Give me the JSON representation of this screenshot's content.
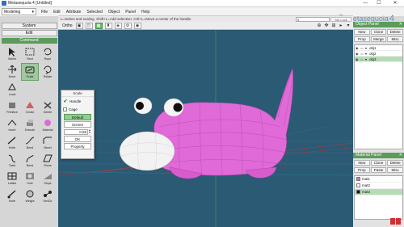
{
  "window": {
    "title": "Metasequoia 4 [Untitled]",
    "minimize": "—",
    "maximize": "☐",
    "close": "✕"
  },
  "menubar": {
    "mode_value": "Modeling",
    "items": [
      "File",
      "Edit",
      "Attribute",
      "Selected",
      "Object",
      "Panel",
      "Help"
    ],
    "logo_text": "metasequoia",
    "logo_version": "4"
  },
  "status": {
    "message": "L=Select and scaling.  Shift+L=Add selection.  Ctrl+L=Move a center of the handle.",
    "coord_value": "0",
    "lock_label": "Set Lock"
  },
  "left_panel": {
    "system_label": "System",
    "edit_label": "Edit",
    "command_label": "Command",
    "commands": [
      {
        "label": "Select",
        "icon": "select-arrow-icon"
      },
      {
        "label": "Rect",
        "icon": "rect-select-icon"
      },
      {
        "label": "Rope",
        "icon": "rope-select-icon"
      },
      {
        "label": "Move",
        "icon": "move-icon"
      },
      {
        "label": "Scale",
        "icon": "scale-icon"
      },
      {
        "label": "Rotate",
        "icon": "rotate-icon"
      },
      {
        "label": "Local",
        "icon": "local-icon"
      },
      {
        "label": "",
        "icon": "blank"
      },
      {
        "label": "",
        "icon": "blank"
      },
      {
        "label": "Primitive",
        "icon": "primitive-icon"
      },
      {
        "label": "Create",
        "icon": "create-icon"
      },
      {
        "label": "Delete",
        "icon": "delete-icon"
      },
      {
        "label": "Invert",
        "icon": "invert-icon"
      },
      {
        "label": "Extrude",
        "icon": "extrude-icon"
      },
      {
        "label": "Material",
        "icon": "material-icon"
      },
      {
        "label": "Knife",
        "icon": "knife-icon"
      },
      {
        "label": "Bend",
        "icon": "bend-icon"
      },
      {
        "label": "Bevel",
        "icon": "bevel-icon"
      },
      {
        "label": "Twist",
        "icon": "twist-icon"
      },
      {
        "label": "Bend",
        "icon": "bend2-icon"
      },
      {
        "label": "Shear",
        "icon": "shear-icon"
      },
      {
        "label": "Lattice",
        "icon": "lattice-icon"
      },
      {
        "label": "Hole",
        "icon": "hole-icon"
      },
      {
        "label": "Slope",
        "icon": "slope-icon"
      },
      {
        "label": "Knife",
        "icon": "knife2-icon"
      },
      {
        "label": "Weight",
        "icon": "weight-icon"
      },
      {
        "label": "VertCtr",
        "icon": "vertctr-icon"
      }
    ],
    "active_command": "Scale"
  },
  "viewport": {
    "ortho_label": "Ortho",
    "tool_buttons": [
      "▣",
      "◫",
      "▦",
      "♜",
      "◈",
      "⚙",
      "◉"
    ],
    "right_tools": [
      "⊕",
      "✥",
      "⊞",
      "▸",
      "▾"
    ]
  },
  "scale_popup": {
    "title": "Scale",
    "handle_label": "Handle",
    "cage_label": "Cage",
    "default_label": "Default",
    "screen_label": "Screen",
    "value": "0.55",
    "ok_label": "OK",
    "property_label": "Property"
  },
  "object_panel": {
    "title": "Object Panel",
    "buttons": [
      "New",
      "Clone",
      "Delete"
    ],
    "buttons2": [
      "Prop",
      "Merge",
      "Misc"
    ],
    "objects": [
      {
        "name": "obj1",
        "selected": false
      },
      {
        "name": "obj2",
        "selected": false
      },
      {
        "name": "obj3",
        "selected": true
      }
    ]
  },
  "material_panel": {
    "title": "Material Panel",
    "buttons": [
      "New",
      "Clone",
      "Delete"
    ],
    "buttons2": [
      "Prop",
      "Paste",
      "Misc"
    ],
    "materials": [
      {
        "name": "mat1",
        "color": "#e06ad8",
        "selected": false
      },
      {
        "name": "mat2",
        "color": "#ffffff",
        "selected": false
      },
      {
        "name": "mat3",
        "color": "#111111",
        "selected": true
      }
    ]
  },
  "colors": {
    "accent_green": "#5b9b5b",
    "viewport_bg": "#2b5a74",
    "model_pink": "#e06ad8",
    "model_white": "#f2f2f2"
  }
}
